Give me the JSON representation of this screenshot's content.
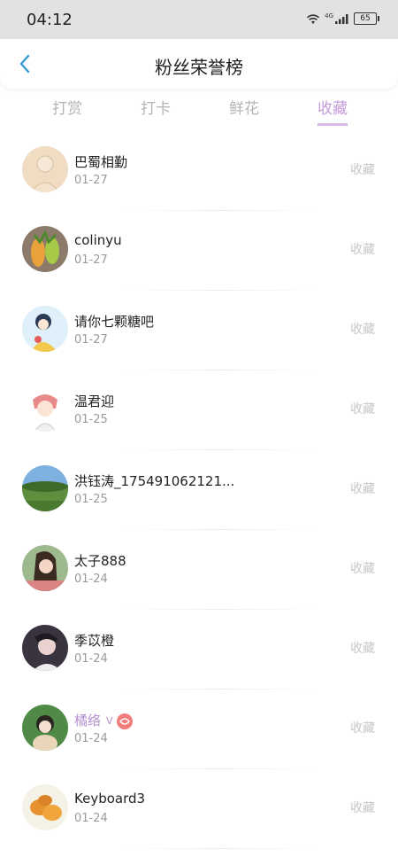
{
  "status_bar": {
    "time": "04:12",
    "network_label": "4G",
    "battery": "65",
    "icons": [
      "wifi-icon",
      "signal-icon",
      "battery-icon"
    ]
  },
  "header": {
    "title": "粉丝荣誉榜",
    "back_icon": "chevron-left-icon",
    "back_color": "#3a98d6"
  },
  "tabs": [
    {
      "label": "打赏",
      "active": false
    },
    {
      "label": "打卡",
      "active": false
    },
    {
      "label": "鲜花",
      "active": false
    },
    {
      "label": "收藏",
      "active": true
    }
  ],
  "colors": {
    "accent": "#c39ad8",
    "muted_text": "#9a9a9a",
    "action_text": "#c7c7c7"
  },
  "list": [
    {
      "name": "巴蜀相勤",
      "date": "01-27",
      "action": "收藏"
    },
    {
      "name": "colinyu",
      "date": "01-27",
      "action": "收藏"
    },
    {
      "name": "请你七颗糖吧",
      "date": "01-27",
      "action": "收藏"
    },
    {
      "name": "温君迎",
      "date": "01-25",
      "action": "收藏"
    },
    {
      "name": "洪钰涛_175491062121...",
      "date": "01-25",
      "action": "收藏"
    },
    {
      "name": "太子888",
      "date": "01-24",
      "action": "收藏"
    },
    {
      "name": "季苡橙",
      "date": "01-24",
      "action": "收藏"
    },
    {
      "name": "橘络",
      "date": "01-24",
      "action": "收藏",
      "badge_v": "ᐯ",
      "has_gift_badge": true
    },
    {
      "name": "Keyboard3",
      "date": "01-24",
      "action": "收藏"
    }
  ]
}
